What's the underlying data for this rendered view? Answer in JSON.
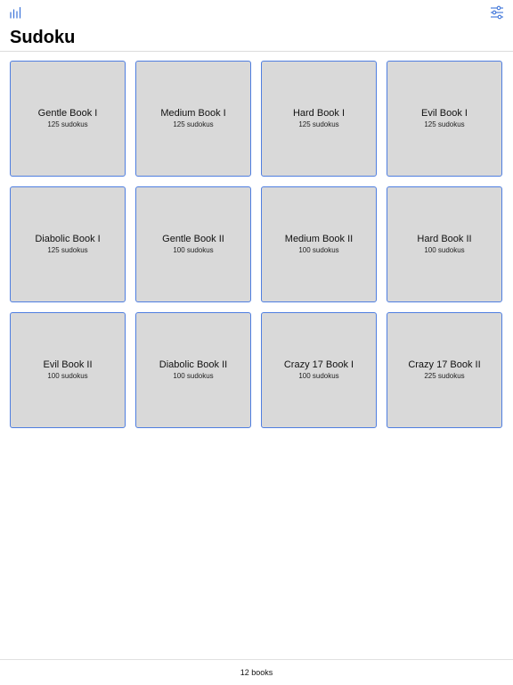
{
  "header": {
    "title": "Sudoku",
    "stats_icon": "bar-chart-icon",
    "filter_icon": "sliders-icon",
    "accent_color": "#3b73d9"
  },
  "books": [
    {
      "title": "Gentle Book I",
      "count": "125 sudokus"
    },
    {
      "title": "Medium Book I",
      "count": "125 sudokus"
    },
    {
      "title": "Hard Book I",
      "count": "125 sudokus"
    },
    {
      "title": "Evil Book I",
      "count": "125 sudokus"
    },
    {
      "title": "Diabolic Book I",
      "count": "125 sudokus"
    },
    {
      "title": "Gentle Book II",
      "count": "100 sudokus"
    },
    {
      "title": "Medium Book II",
      "count": "100 sudokus"
    },
    {
      "title": "Hard Book II",
      "count": "100 sudokus"
    },
    {
      "title": "Evil Book II",
      "count": "100 sudokus"
    },
    {
      "title": "Diabolic Book II",
      "count": "100 sudokus"
    },
    {
      "title": "Crazy 17 Book I",
      "count": "100 sudokus"
    },
    {
      "title": "Crazy 17 Book II",
      "count": "225 sudokus"
    }
  ],
  "footer": {
    "summary": "12 books"
  }
}
